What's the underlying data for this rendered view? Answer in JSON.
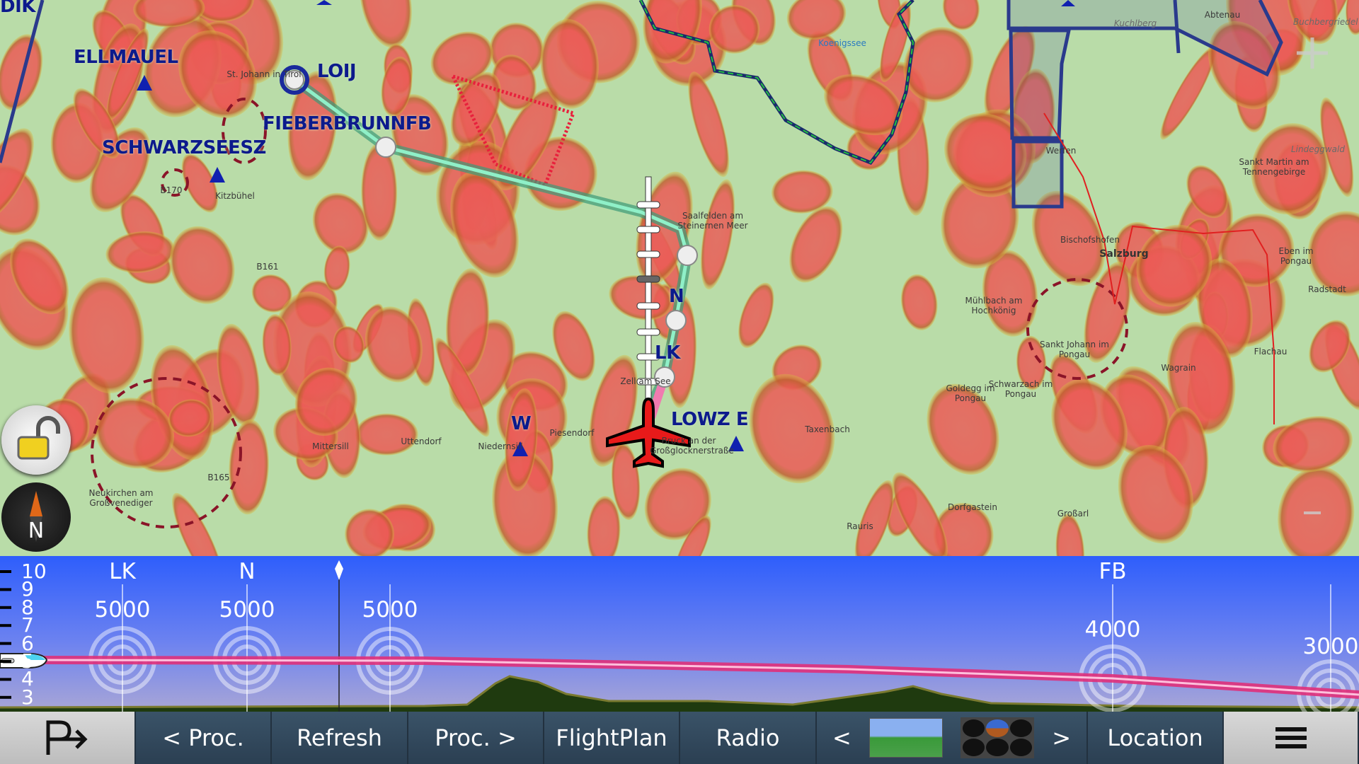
{
  "map": {
    "waypoints": [
      {
        "id": "ellmauel",
        "label": "ELLMAUEL"
      },
      {
        "id": "loij",
        "label": "LOIJ"
      },
      {
        "id": "fieberbrunn",
        "label": "FIEBERBRUNNFB"
      },
      {
        "id": "schwarzsee",
        "label": "SCHWARZSEESZ"
      },
      {
        "id": "n",
        "label": "N"
      },
      {
        "id": "lk",
        "label": "LK"
      },
      {
        "id": "w",
        "label": "W"
      },
      {
        "id": "lowz",
        "label": "LOWZ E"
      },
      {
        "id": "dik",
        "label": "DIK"
      }
    ],
    "towns": [
      "St. Johann in Tirol",
      "Kitzbühel",
      "B170",
      "B161",
      "B165",
      "Saalfelden am Steinernen Meer",
      "Mittersill",
      "Uttendorf",
      "Niedernsill",
      "Piesendorf",
      "Zell am See",
      "Bruck an der Großglocknerstraße",
      "Taxenbach",
      "Neukirchen am Großvenediger",
      "Koenigssee",
      "Abtenau",
      "Werfen",
      "Bischofshofen",
      "Salzburg",
      "Sankt Martin am Tennengebirge",
      "Eben im Pongau",
      "Radstadt",
      "Mühlbach am Hochkönig",
      "Sankt Johann im Pongau",
      "Wagrain",
      "Flachau",
      "Goldegg im Pongau",
      "Schwarzach im Pongau",
      "Dorfgastein",
      "Großarl",
      "Rauris",
      "Lindeggwald",
      "Kuchlberg",
      "Buchbergriedel"
    ],
    "colors": {
      "route": "#5fcf9e",
      "airspace": "#2a3a8c",
      "restricted": "#e8203c",
      "terrain_high": "#ec5a55",
      "valley": "#b9dca8"
    }
  },
  "profile": {
    "scale": [
      "10",
      "9",
      "8",
      "7",
      "6",
      "5",
      "4",
      "3"
    ],
    "points": [
      {
        "name": "LK",
        "alt": "5000"
      },
      {
        "name": "N",
        "alt": "5000"
      },
      {
        "name": "",
        "alt": "5000"
      },
      {
        "name": "FB",
        "alt": "4000"
      },
      {
        "name": "",
        "alt": "3000"
      }
    ]
  },
  "toolbar": {
    "procedure_icon": "procedure-arrow-icon",
    "prev_proc": "< Proc.",
    "refresh": "Refresh",
    "next_proc": "Proc. >",
    "flightplan": "FlightPlan",
    "radio": "Radio",
    "prev": "<",
    "next": ">",
    "location": "Location",
    "menu_icon": "hamburger-menu-icon"
  }
}
